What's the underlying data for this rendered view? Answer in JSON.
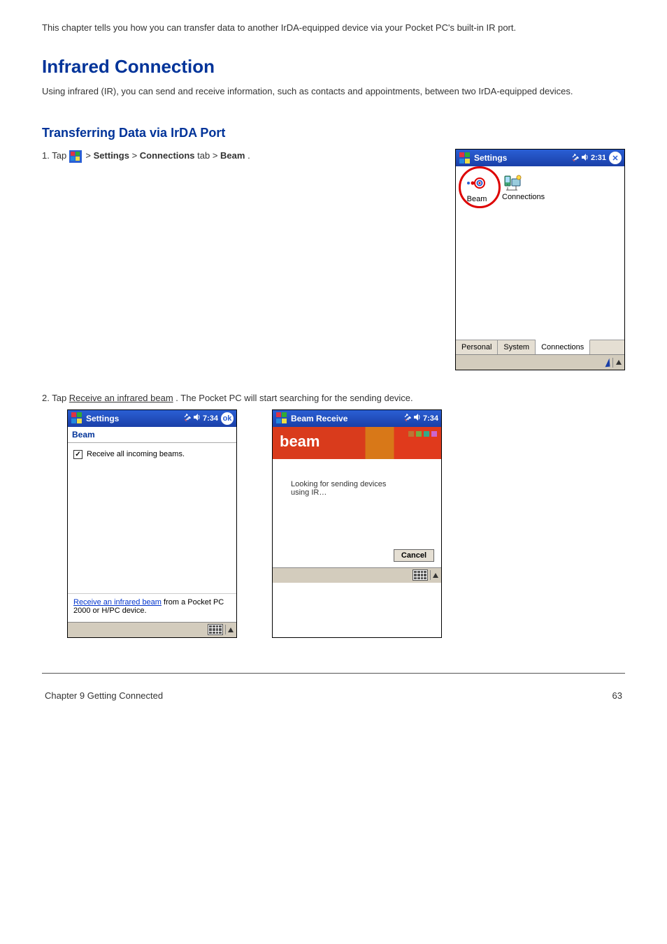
{
  "doc": {
    "intro": "This chapter tells you how you can transfer data to another IrDA-equipped device via your Pocket PC's built-in IR port.",
    "section_title": "Infrared Connection",
    "section_text": "Using infrared (IR), you can send and receive information, such as contacts and appointments, between two IrDA-equipped devices.",
    "sub_title": "Transferring Data via IrDA Port",
    "step1_prefix": "1. Tap ",
    "step1_mid": " > ",
    "step1_bold1": "Settings",
    "step1_sep": " > ",
    "step1_bold2": "Connections",
    "step1_tab": " tab > ",
    "step1_bold3": "Beam",
    "step1_end": ".",
    "step2_prefix": "2. Tap ",
    "step2_link": "Receive an infrared beam",
    "step2_end": ". The Pocket PC will start searching for the sending device."
  },
  "ss1": {
    "title": "Settings",
    "time": "2:31",
    "icon1_label": "Beam",
    "icon2_label": "Connections",
    "tabs": [
      "Personal",
      "System",
      "Connections"
    ],
    "close_label": "✕"
  },
  "ss2": {
    "title": "Settings",
    "time": "7:34",
    "close_label": "ok",
    "sub": "Beam",
    "checkbox_label": "Receive all incoming beams.",
    "link": "Receive an infrared beam",
    "link_tail": " from a Pocket PC 2000 or H/PC device."
  },
  "ss3": {
    "title": "Beam Receive",
    "time": "7:34",
    "banner": "beam",
    "body": "Looking for sending devices using IR…",
    "cancel": "Cancel"
  },
  "footer": {
    "chapter": "Chapter 9   Getting Connected",
    "page": "63"
  }
}
